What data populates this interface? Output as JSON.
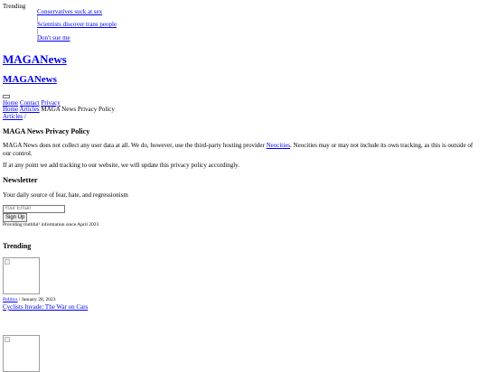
{
  "trending_bar": {
    "label": "Trending",
    "items": [
      {
        "title": "Conservatives suck at sex"
      },
      {
        "title": "Scientists discover trans people"
      },
      {
        "title": "Don't sue me"
      }
    ]
  },
  "site": {
    "logo": "MAGANews",
    "logo_secondary": "MAGANews"
  },
  "nav": {
    "items": [
      "Home",
      "Contact",
      "Privacy"
    ]
  },
  "breadcrumb": {
    "home": "Home",
    "articles": "Articles",
    "current": "MAGA News Privacy Policy",
    "articles2": "Articles",
    "sep": "/"
  },
  "policy": {
    "title": "MAGA News Privacy Policy",
    "para1_before": "MAGA News does not collect any user data at all. We do, however, use the third-party hosting provider ",
    "para1_link": "Neocities",
    "para1_after": ". Neocities may or may not include its own tracking, as this is outside of our control.",
    "para2": "If at any point we add tracking to our website, we will update this privacy policy accordingly."
  },
  "newsletter": {
    "title": "Newsletter",
    "description": "Your daily source of fear, hate, and regressionism",
    "email_placeholder": "Your Email",
    "signup_label": "Sign Up",
    "tagline": "Providing truthful¹ information since April 2023"
  },
  "trending_section": {
    "title": "Trending",
    "articles": [
      {
        "category": "Politics",
        "date": "January 28, 2023",
        "title": "Cyclists Invade: The War on Cars"
      }
    ]
  }
}
